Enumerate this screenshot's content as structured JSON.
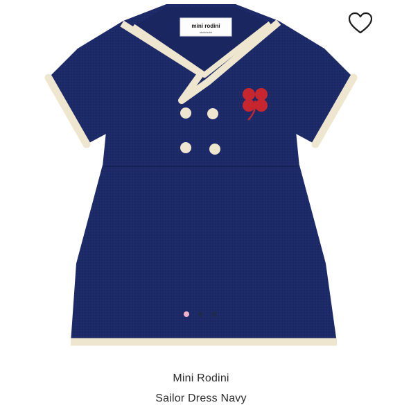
{
  "product": {
    "brand": "Mini Rodini",
    "title": "Sailor Dress Navy",
    "label_text": "mini rodini",
    "label_subtext": "stockholm"
  },
  "gallery": {
    "image_count": 3,
    "active_index": 0
  },
  "icons": {
    "wishlist": "heart-outline-icon",
    "embroidery": "clover-icon"
  },
  "colors": {
    "dress": "#1d2a68",
    "trim": "#efe6cf",
    "clover": "#c8262f",
    "dot_active": "#f1b3cb",
    "dot_inactive": "#1f2a4d",
    "text": "#2b2b2b"
  }
}
